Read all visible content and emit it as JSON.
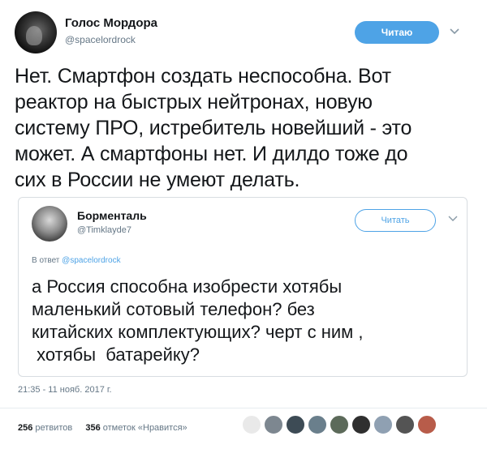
{
  "tweet": {
    "author_name": "Голос Мордора",
    "author_handle": "@spacelordrock",
    "follow_label": "Читаю",
    "text_lines": [
      "Нет. Смартфон создать неспособна. Вот",
      "реактор на быстрых нейтронах, новую",
      "систему ПРО, истребитель новейший - это",
      "может. А смартфоны нет. И дилдо тоже до",
      "сих в России не умеют делать."
    ],
    "timestamp": "21:35 - 11 нояб. 2017 г.",
    "retweets_count": "256",
    "retweets_label": "ретвитов",
    "likes_count": "356",
    "likes_label": "отметок «Нравится»"
  },
  "quoted": {
    "author_name": "Борменталь",
    "author_handle": "@Timklayde7",
    "follow_label": "Читать",
    "reply_prefix": "В ответ",
    "reply_handle": "@spacelordrock",
    "text_lines": [
      "а Россия способна изобрести хотябы",
      "маленький сотовый телефон?  без",
      "китайских комплектующих? черт с ним ,",
      " хотябы  батарейку?"
    ]
  },
  "likers": [
    {
      "icon": "liker-avatar-1",
      "color": "#e9e9e9"
    },
    {
      "icon": "liker-avatar-2",
      "color": "#7d8790"
    },
    {
      "icon": "liker-avatar-3",
      "color": "#3d4b55"
    },
    {
      "icon": "liker-avatar-4",
      "color": "#6a7f8c"
    },
    {
      "icon": "liker-avatar-5",
      "color": "#5c6a5a"
    },
    {
      "icon": "liker-avatar-6",
      "color": "#2f2f2f"
    },
    {
      "icon": "liker-avatar-7",
      "color": "#8fa0b2"
    },
    {
      "icon": "liker-avatar-8",
      "color": "#545454"
    },
    {
      "icon": "liker-avatar-9",
      "color": "#b85c4a"
    }
  ],
  "colors": {
    "accent": "#4ea3e6",
    "text": "#14171a",
    "muted": "#657786"
  }
}
